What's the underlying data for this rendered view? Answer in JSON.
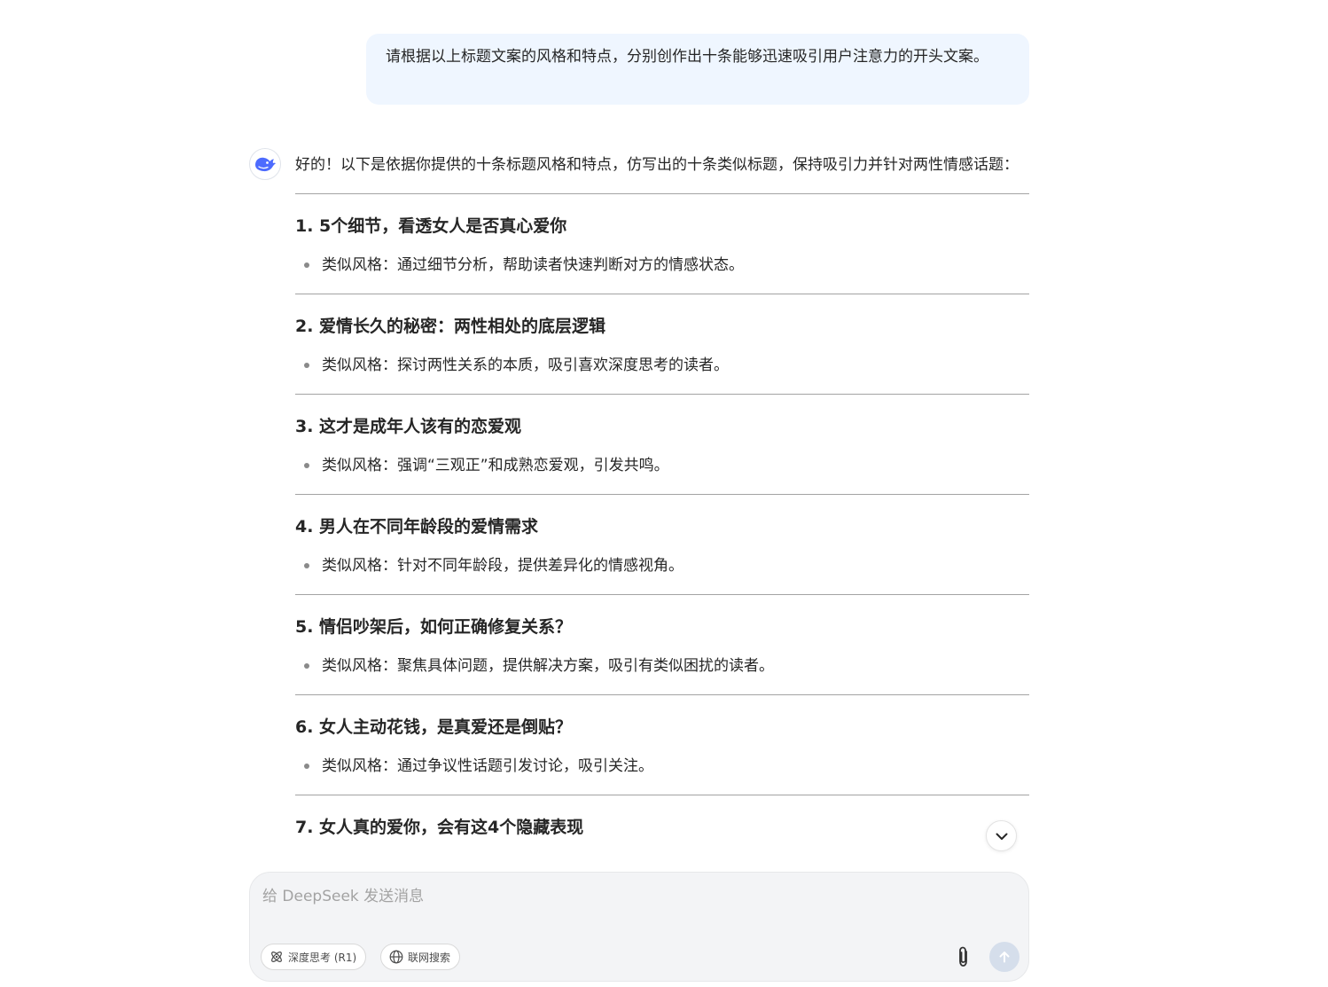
{
  "user_message": "请根据以上标题文案的风格和特点，分别创作出十条能够迅速吸引用户注意力的开头文案。",
  "assistant": {
    "intro": "好的！以下是依据你提供的十条标题风格和特点，仿写出的十条类似标题，保持吸引力并针对两性情感话题：",
    "items": [
      {
        "title": "1. 5个细节，看透女人是否真心爱你",
        "bullet": "类似风格：通过细节分析，帮助读者快速判断对方的情感状态。"
      },
      {
        "title": "2. 爱情长久的秘密：两性相处的底层逻辑",
        "bullet": "类似风格：探讨两性关系的本质，吸引喜欢深度思考的读者。"
      },
      {
        "title": "3. 这才是成年人该有的恋爱观",
        "bullet": "类似风格：强调“三观正”和成熟恋爱观，引发共鸣。"
      },
      {
        "title": "4. 男人在不同年龄段的爱情需求",
        "bullet": "类似风格：针对不同年龄段，提供差异化的情感视角。"
      },
      {
        "title": "5. 情侣吵架后，如何正确修复关系？",
        "bullet": "类似风格：聚焦具体问题，提供解决方案，吸引有类似困扰的读者。"
      },
      {
        "title": "6. 女人主动花钱，是真爱还是倒贴？",
        "bullet": "类似风格：通过争议性话题引发讨论，吸引关注。"
      },
      {
        "title": "7. 女人真的爱你，会有这4个隐藏表现",
        "bullet": ""
      }
    ]
  },
  "composer": {
    "placeholder": "给 DeepSeek 发送消息",
    "deep_think_label": "深度思考 (R1)",
    "web_search_label": "联网搜索"
  },
  "colors": {
    "user_bubble_bg": "#eff6ff",
    "brand_blue": "#4d6bfe",
    "composer_bg": "#f3f4f6",
    "send_button_disabled": "#d5deeb"
  },
  "icons": [
    "deepseek-whale-icon",
    "chevron-down-icon",
    "atom-icon",
    "globe-icon",
    "paperclip-icon",
    "arrow-up-icon"
  ]
}
